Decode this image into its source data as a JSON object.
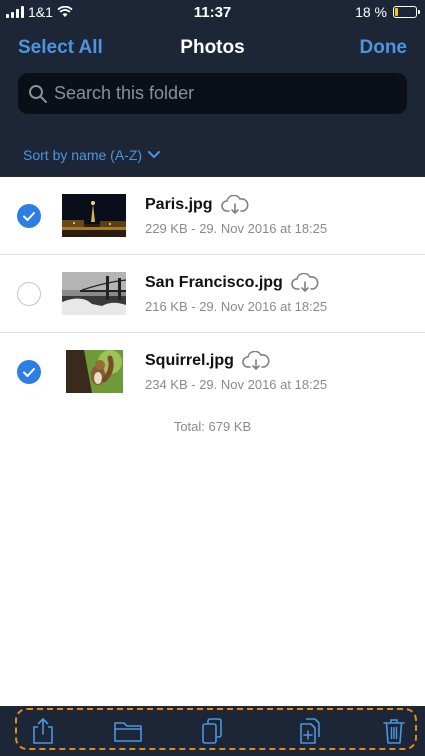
{
  "status_bar": {
    "carrier": "1&1",
    "time": "11:37",
    "battery_percent": "18 %",
    "battery_level": 0.18
  },
  "nav": {
    "left_label": "Select All",
    "title": "Photos",
    "right_label": "Done"
  },
  "search": {
    "placeholder": "Search this folder"
  },
  "sort": {
    "label": "Sort by name (A-Z)"
  },
  "files": [
    {
      "name": "Paris.jpg",
      "meta": "229 KB - 29. Nov 2016 at 18:25",
      "selected": true
    },
    {
      "name": "San Francisco.jpg",
      "meta": "216 KB - 29. Nov 2016 at 18:25",
      "selected": false
    },
    {
      "name": "Squirrel.jpg",
      "meta": "234 KB - 29. Nov 2016 at 18:25",
      "selected": true
    }
  ],
  "total": "Total: 679 KB",
  "toolbar": [
    "share-icon",
    "folder-icon",
    "copy-icon",
    "add-document-icon",
    "trash-icon"
  ],
  "colors": {
    "header_bg": "#1c2636",
    "accent": "#4d95de",
    "check": "#2d7de6",
    "highlight": "#e68a18",
    "battery": "#f5d000"
  }
}
